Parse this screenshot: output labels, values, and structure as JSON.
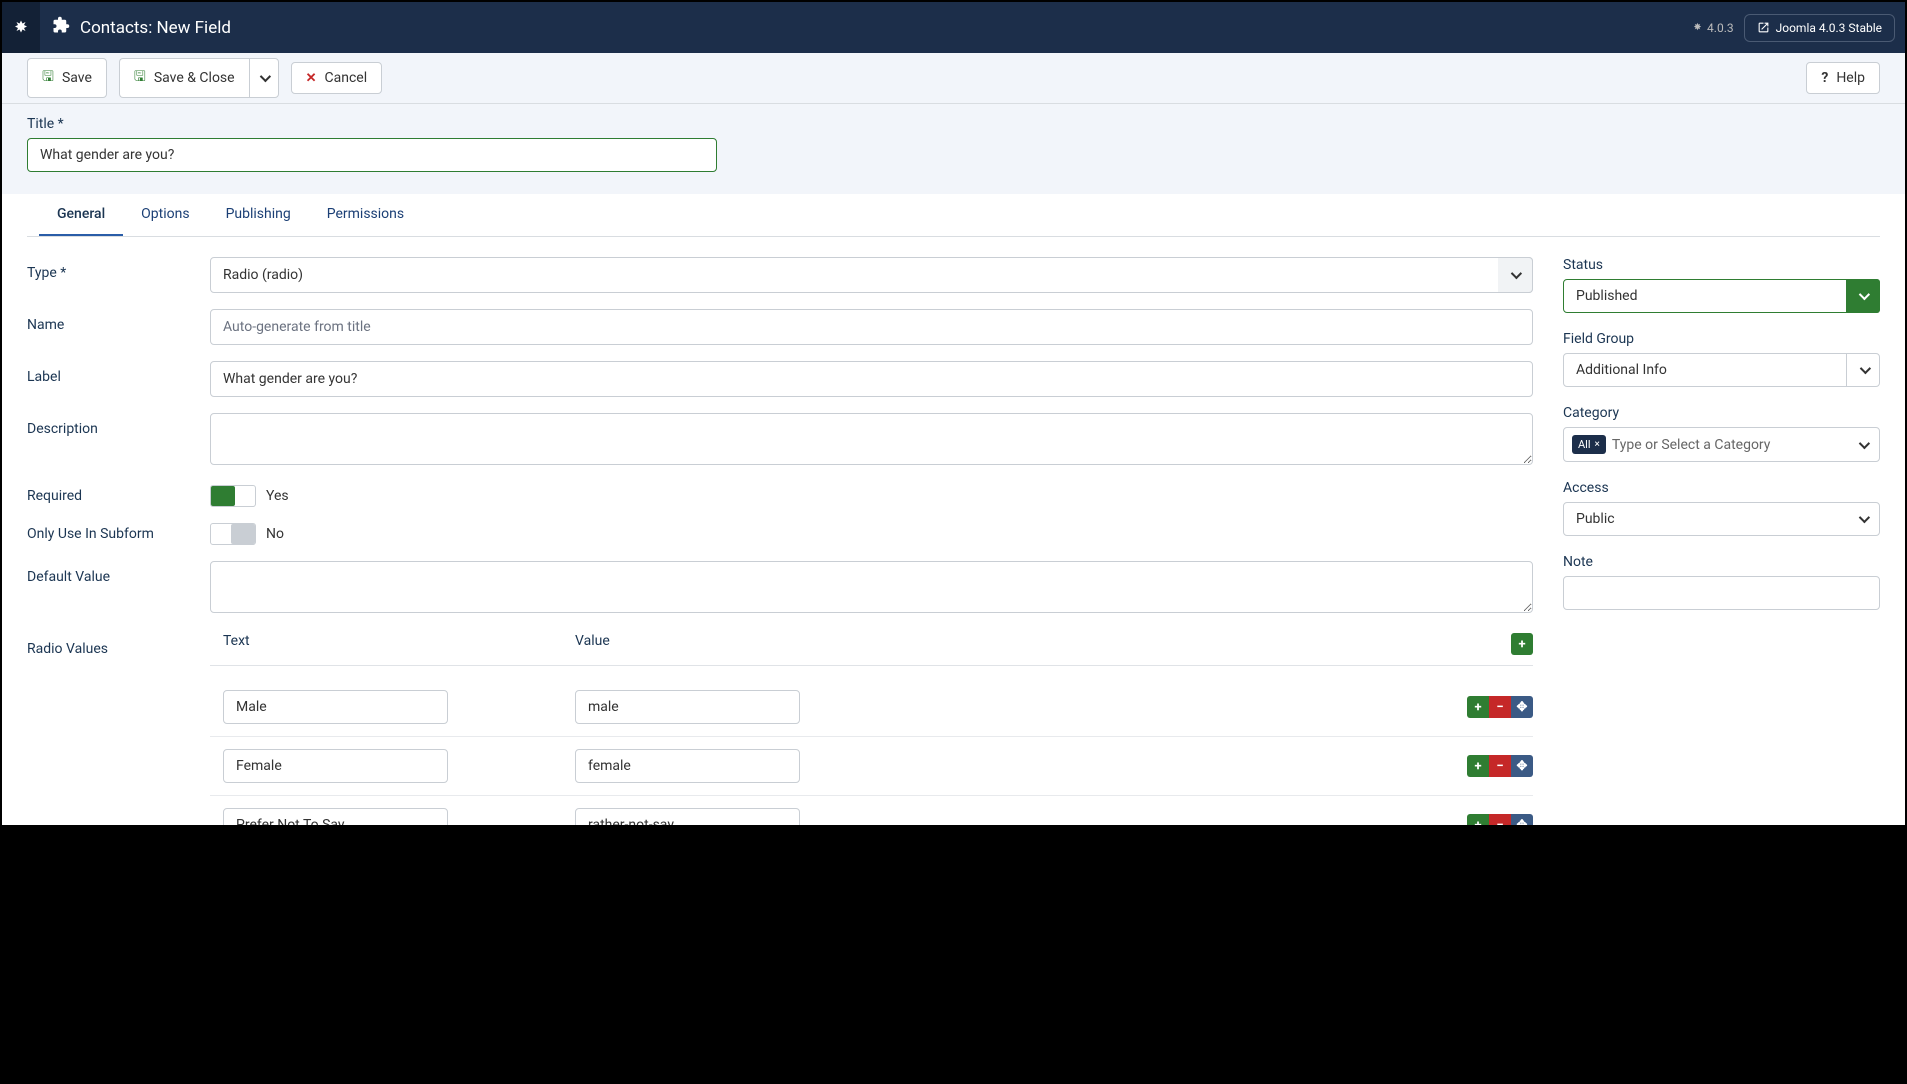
{
  "header": {
    "page_title": "Contacts: New Field",
    "version_small": "4.0.3",
    "version_badge": "Joomla 4.0.3 Stable"
  },
  "toolbar": {
    "save": "Save",
    "save_close": "Save & Close",
    "cancel": "Cancel",
    "help": "Help"
  },
  "title": {
    "label": "Title *",
    "value": "What gender are you?"
  },
  "tabs": [
    "General",
    "Options",
    "Publishing",
    "Permissions"
  ],
  "form": {
    "type_label": "Type *",
    "type_value": "Radio (radio)",
    "name_label": "Name",
    "name_placeholder": "Auto-generate from title",
    "label_label": "Label",
    "label_value": "What gender are you?",
    "desc_label": "Description",
    "desc_value": "",
    "required_label": "Required",
    "required_text": "Yes",
    "subform_label": "Only Use In Subform",
    "subform_text": "No",
    "default_label": "Default Value",
    "default_value": "",
    "radio_label": "Radio Values",
    "radio_header_text": "Text",
    "radio_header_value": "Value",
    "radio_values": [
      {
        "text": "Male",
        "value": "male"
      },
      {
        "text": "Female",
        "value": "female"
      },
      {
        "text": "Prefer Not To Say",
        "value": "rather-not-say"
      }
    ]
  },
  "side": {
    "status_label": "Status",
    "status_value": "Published",
    "group_label": "Field Group",
    "group_value": "Additional Info",
    "category_label": "Category",
    "category_chip": "All",
    "category_placeholder": "Type or Select a Category",
    "access_label": "Access",
    "access_value": "Public",
    "note_label": "Note",
    "note_value": ""
  }
}
